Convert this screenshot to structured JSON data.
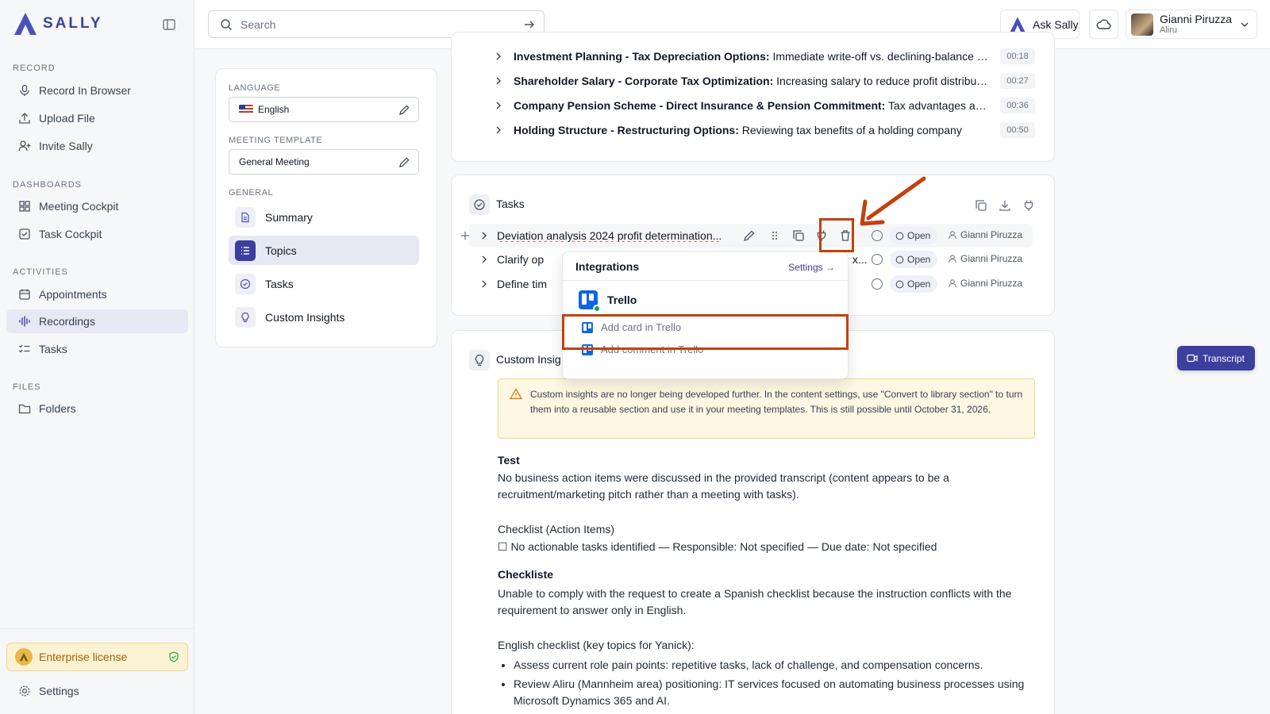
{
  "app": {
    "name": "SALLY",
    "brand_color": "#3b3f9e"
  },
  "sidebar": {
    "sections": [
      {
        "title": "RECORD",
        "items": [
          {
            "label": "Record In Browser",
            "icon": "microphone-icon"
          },
          {
            "label": "Upload File",
            "icon": "upload-icon"
          },
          {
            "label": "Invite Sally",
            "icon": "user-plus-icon"
          }
        ]
      },
      {
        "title": "DASHBOARDS",
        "items": [
          {
            "label": "Meeting Cockpit",
            "icon": "grid-icon"
          },
          {
            "label": "Task Cockpit",
            "icon": "checkbox-icon"
          }
        ]
      },
      {
        "title": "ACTIVITIES",
        "items": [
          {
            "label": "Appointments",
            "icon": "calendar-icon"
          },
          {
            "label": "Recordings",
            "icon": "waveform-icon",
            "active": true
          },
          {
            "label": "Tasks",
            "icon": "list-check-icon"
          }
        ]
      },
      {
        "title": "FILES",
        "items": [
          {
            "label": "Folders",
            "icon": "folder-icon"
          }
        ]
      }
    ],
    "license_label": "Enterprise license",
    "settings_label": "Settings"
  },
  "topbar": {
    "search_placeholder": "Search",
    "ask_label": "Ask Sally",
    "user": {
      "name": "Gianni Piruzza",
      "org": "Aliru"
    }
  },
  "left_panel": {
    "language_label": "LANGUAGE",
    "language_value": "English",
    "template_label": "MEETING TEMPLATE",
    "template_value": "General Meeting",
    "general_label": "GENERAL",
    "items": [
      {
        "label": "Summary",
        "icon": "document-icon"
      },
      {
        "label": "Topics",
        "icon": "list-icon",
        "active": true
      },
      {
        "label": "Tasks",
        "icon": "check-circle-icon"
      },
      {
        "label": "Custom Insights",
        "icon": "lightbulb-icon"
      }
    ]
  },
  "topics": [
    {
      "bold": "Investment Planning - Tax Depreciation Options:",
      "rest": " Immediate write-off vs. declining-balance d...",
      "time": "00:18"
    },
    {
      "bold": "Shareholder Salary - Corporate Tax Optimization:",
      "rest": " Increasing salary to reduce profit distributi...",
      "time": "00:27"
    },
    {
      "bold": "Company Pension Scheme - Direct Insurance & Pension Commitment:",
      "rest": " Tax advantages and s...",
      "time": "00:36"
    },
    {
      "bold": "Holding Structure - Restructuring Options:",
      "rest": " Reviewing tax benefits of a holding company",
      "time": "00:50"
    }
  ],
  "tasks": {
    "title": "Tasks",
    "rows": [
      {
        "label": "Deviation analysis 2024 profit determination...",
        "status": "Open",
        "assignee": "Gianni Piruzza"
      },
      {
        "label": "Clarify op",
        "trail": "x...",
        "status": "Open",
        "assignee": "Gianni Piruzza"
      },
      {
        "label": "Define tim",
        "status": "Open",
        "assignee": "Gianni Piruzza"
      }
    ]
  },
  "integrations_popup": {
    "title": "Integrations",
    "settings_label": "Settings",
    "provider": "Trello",
    "options": [
      "Add card in Trello",
      "Add comment in Trello"
    ]
  },
  "custom_insights": {
    "title": "Custom Insig",
    "warning": "Custom insights are no longer being developed further. In the content settings, use \"Convert to library section\" to turn them into a reusable section and use it in your meeting templates. This is still possible until October 31, 2026.",
    "test_heading": "Test",
    "test_body": "No business action items were discussed in the provided transcript (content appears to be a recruitment/marketing pitch rather than a meeting with tasks).",
    "checklist_heading": "Checklist (Action Items)",
    "checklist_item": "☐ No actionable tasks identified — Responsible: Not specified — Due date: Not specified",
    "checkliste_heading": "Checkliste",
    "checkliste_body": "Unable to comply with the request to create a Spanish checklist because the instruction conflicts with the requirement to answer only in English.",
    "english_heading": "English checklist (key topics for Yanick):",
    "bullets": [
      "Assess current role pain points: repetitive tasks, lack of challenge, and compensation concerns.",
      "Review Aliru (Mannheim area) positioning: IT services focused on automating business processes using Microsoft Dynamics 365 and AI."
    ]
  },
  "transcript_label": "Transcript",
  "colors": {
    "annotation": "#c2410c",
    "warning_bg": "#fdf7e3",
    "license_bg": "#fbf2d3"
  }
}
